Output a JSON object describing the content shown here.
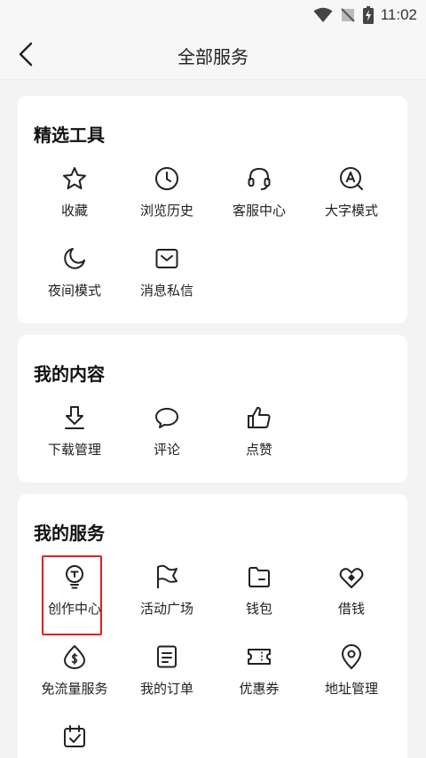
{
  "status_bar": {
    "time": "11:02"
  },
  "header": {
    "title": "全部服务"
  },
  "sections": [
    {
      "title": "精选工具",
      "items": [
        {
          "label": "收藏",
          "icon": "star-icon"
        },
        {
          "label": "浏览历史",
          "icon": "clock-icon"
        },
        {
          "label": "客服中心",
          "icon": "headset-icon"
        },
        {
          "label": "大字模式",
          "icon": "font-size-icon"
        },
        {
          "label": "夜间模式",
          "icon": "moon-icon"
        },
        {
          "label": "消息私信",
          "icon": "mail-icon"
        }
      ]
    },
    {
      "title": "我的内容",
      "items": [
        {
          "label": "下载管理",
          "icon": "download-icon"
        },
        {
          "label": "评论",
          "icon": "comment-icon"
        },
        {
          "label": "点赞",
          "icon": "thumbs-up-icon"
        }
      ]
    },
    {
      "title": "我的服务",
      "items": [
        {
          "label": "创作中心",
          "icon": "lightbulb-icon"
        },
        {
          "label": "活动广场",
          "icon": "flag-icon"
        },
        {
          "label": "钱包",
          "icon": "wallet-icon"
        },
        {
          "label": "借钱",
          "icon": "heart-loan-icon"
        },
        {
          "label": "免流量服务",
          "icon": "data-saver-icon"
        },
        {
          "label": "我的订单",
          "icon": "order-icon"
        },
        {
          "label": "优惠券",
          "icon": "coupon-icon"
        },
        {
          "label": "地址管理",
          "icon": "location-icon"
        },
        {
          "label": "",
          "icon": "calendar-check-icon"
        }
      ]
    }
  ],
  "highlight_color": "#e0201b"
}
